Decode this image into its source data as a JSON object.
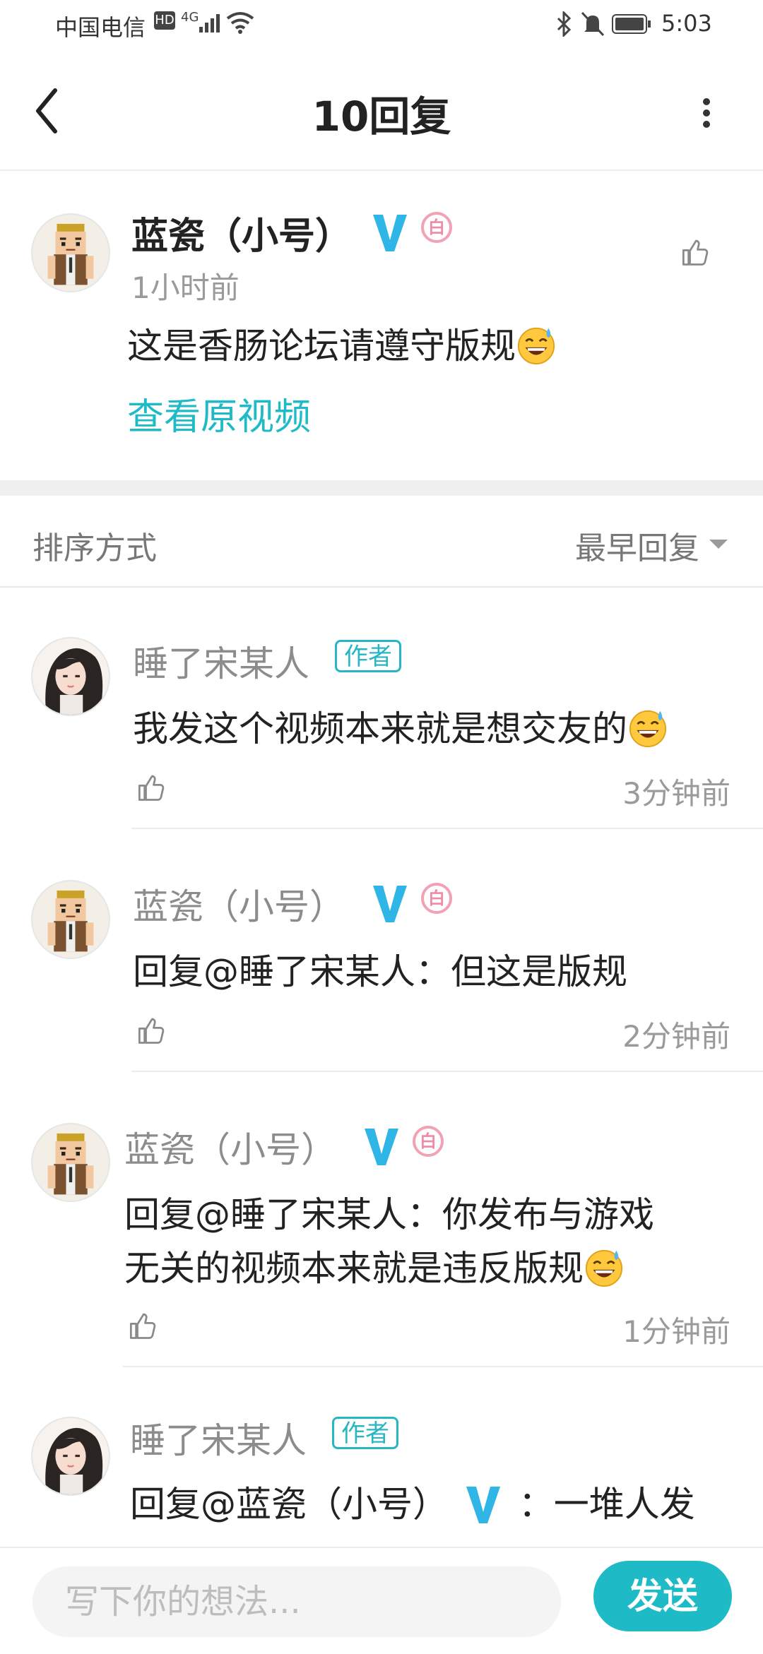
{
  "status_bar": {
    "carrier": "中国电信",
    "network": "4G",
    "time": "5:03"
  },
  "nav": {
    "title": "10回复"
  },
  "main_post": {
    "author": "蓝瓷（小号）",
    "level_badge": "白",
    "time": "1小时前",
    "text": "这是香肠论坛请遵守版规",
    "view_original": "查看原视频"
  },
  "sort": {
    "label": "排序方式",
    "selected": "最早回复"
  },
  "replies": [
    {
      "author": "睡了宋某人",
      "tag": "作者",
      "text": "我发这个视频本来就是想交友的",
      "time": "3分钟前"
    },
    {
      "author": "蓝瓷（小号）",
      "level_badge": "白",
      "text": "回复@睡了宋某人：但这是版规",
      "time": "2分钟前"
    },
    {
      "author": "蓝瓷（小号）",
      "level_badge": "白",
      "text_line1": "回复@睡了宋某人：你发布与游戏",
      "text_line2": "无关的视频本来就是违反版规",
      "time": "1分钟前"
    },
    {
      "author": "睡了宋某人",
      "tag": "作者",
      "text_prefix": "回复@蓝瓷（小号）",
      "text_suffix": "：一堆人发"
    }
  ],
  "input": {
    "placeholder": "写下你的想法...",
    "send_label": "发送"
  },
  "colors": {
    "accent": "#1ebbc7",
    "vip_blue": "#2fb5e6",
    "level_pink": "#f08aa5"
  }
}
